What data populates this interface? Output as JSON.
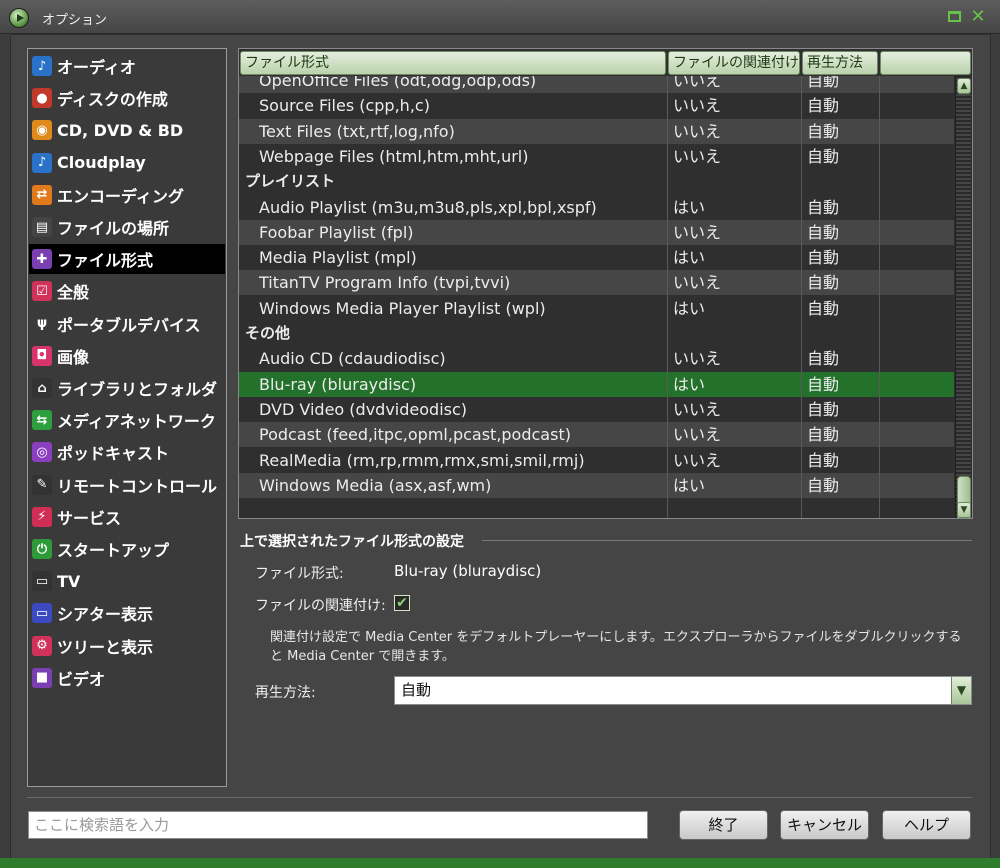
{
  "window": {
    "title": "オプション"
  },
  "sidebar": {
    "selected_index": 6,
    "items": [
      {
        "label": "オーディオ",
        "icon": "music-note-icon",
        "icon_color": "#2a72c8",
        "glyph": "♪"
      },
      {
        "label": "ディスクの作成",
        "icon": "disc-burn-icon",
        "icon_color": "#c0392b",
        "glyph": "●"
      },
      {
        "label": "CD, DVD & BD",
        "icon": "cd-icon",
        "icon_color": "#e08a1e",
        "glyph": "◉"
      },
      {
        "label": "Cloudplay",
        "icon": "music-note-icon",
        "icon_color": "#2a72c8",
        "glyph": "♪"
      },
      {
        "label": "エンコーディング",
        "icon": "encoding-arrows-icon",
        "icon_color": "#e07a1a",
        "glyph": "⇄"
      },
      {
        "label": "ファイルの場所",
        "icon": "file-location-icon",
        "icon_color": "#444444",
        "glyph": "▤"
      },
      {
        "label": "ファイル形式",
        "icon": "puzzle-icon",
        "icon_color": "#7a3fb0",
        "glyph": "✚"
      },
      {
        "label": "全般",
        "icon": "checkbox-icon",
        "icon_color": "#d0325a",
        "glyph": "☑"
      },
      {
        "label": "ポータブルデバイス",
        "icon": "usb-icon",
        "icon_color": "#3a3a3a",
        "glyph": "ψ"
      },
      {
        "label": "画像",
        "icon": "camera-icon",
        "icon_color": "#d8356a",
        "glyph": "◘"
      },
      {
        "label": "ライブラリとフォルダ",
        "icon": "home-icon",
        "icon_color": "#333333",
        "glyph": "⌂"
      },
      {
        "label": "メディアネットワーク",
        "icon": "network-icon",
        "icon_color": "#2e9e3e",
        "glyph": "⇆"
      },
      {
        "label": "ポッドキャスト",
        "icon": "podcast-icon",
        "icon_color": "#8a3fc0",
        "glyph": "◎"
      },
      {
        "label": "リモートコントロール",
        "icon": "remote-icon",
        "icon_color": "#333333",
        "glyph": "✎"
      },
      {
        "label": "サービス",
        "icon": "plug-icon",
        "icon_color": "#d02e55",
        "glyph": "⚡"
      },
      {
        "label": "スタートアップ",
        "icon": "power-icon",
        "icon_color": "#2f9a3a",
        "glyph": "⏻"
      },
      {
        "label": "TV",
        "icon": "tv-icon",
        "icon_color": "#333333",
        "glyph": "▭"
      },
      {
        "label": "シアター表示",
        "icon": "theater-icon",
        "icon_color": "#3b4ac0",
        "glyph": "▭"
      },
      {
        "label": "ツリーと表示",
        "icon": "gear-icon",
        "icon_color": "#d0325a",
        "glyph": "⚙"
      },
      {
        "label": "ビデオ",
        "icon": "video-camera-icon",
        "icon_color": "#7a3fb0",
        "glyph": "■"
      }
    ]
  },
  "table": {
    "headers": [
      "ファイル形式",
      "ファイルの関連付け",
      "再生方法",
      ""
    ],
    "rows": [
      {
        "type": "item",
        "name": "OpenOffice Files (odt,odg,odp,ods)",
        "assoc": "いいえ",
        "play": "自動"
      },
      {
        "type": "item",
        "name": "Source Files (cpp,h,c)",
        "assoc": "いいえ",
        "play": "自動"
      },
      {
        "type": "item",
        "name": "Text Files (txt,rtf,log,nfo)",
        "assoc": "いいえ",
        "play": "自動"
      },
      {
        "type": "item",
        "name": "Webpage Files (html,htm,mht,url)",
        "assoc": "いいえ",
        "play": "自動"
      },
      {
        "type": "group",
        "name": "プレイリスト",
        "assoc": "",
        "play": ""
      },
      {
        "type": "item",
        "name": "Audio Playlist (m3u,m3u8,pls,xpl,bpl,xspf)",
        "assoc": "はい",
        "play": "自動"
      },
      {
        "type": "item",
        "name": "Foobar Playlist (fpl)",
        "assoc": "いいえ",
        "play": "自動"
      },
      {
        "type": "item",
        "name": "Media Playlist (mpl)",
        "assoc": "はい",
        "play": "自動"
      },
      {
        "type": "item",
        "name": "TitanTV Program Info (tvpi,tvvi)",
        "assoc": "いいえ",
        "play": "自動"
      },
      {
        "type": "item",
        "name": "Windows Media Player Playlist (wpl)",
        "assoc": "はい",
        "play": "自動"
      },
      {
        "type": "group",
        "name": "その他",
        "assoc": "",
        "play": ""
      },
      {
        "type": "item",
        "name": "Audio CD (cdaudiodisc)",
        "assoc": "いいえ",
        "play": "自動"
      },
      {
        "type": "item",
        "name": "Blu-ray (bluraydisc)",
        "assoc": "はい",
        "play": "自動",
        "selected": true
      },
      {
        "type": "item",
        "name": "DVD Video (dvdvideodisc)",
        "assoc": "いいえ",
        "play": "自動"
      },
      {
        "type": "item",
        "name": "Podcast (feed,itpc,opml,pcast,podcast)",
        "assoc": "いいえ",
        "play": "自動"
      },
      {
        "type": "item",
        "name": "RealMedia (rm,rp,rmm,rmx,smi,smil,rmj)",
        "assoc": "いいえ",
        "play": "自動"
      },
      {
        "type": "item",
        "name": "Windows Media (asx,asf,wm)",
        "assoc": "はい",
        "play": "自動"
      }
    ]
  },
  "settings": {
    "section_title": "上で選択されたファイル形式の設定",
    "file_type_label": "ファイル形式:",
    "file_type_value": "Blu-ray (bluraydisc)",
    "assoc_label": "ファイルの関連付け:",
    "assoc_checked": true,
    "description": "関連付け設定で Media Center をデフォルトプレーヤーにします。エクスプローラからファイルをダブルクリックすると Media Center で開きます。",
    "play_label": "再生方法:",
    "play_value": "自動"
  },
  "footer": {
    "search_placeholder": "ここに検索語を入力",
    "ok_label": "終了",
    "cancel_label": "キャンセル",
    "help_label": "ヘルプ"
  },
  "colors": {
    "accent": "#23712b",
    "header_gradient_top": "#e4eedd",
    "header_text": "#1b3a12"
  }
}
